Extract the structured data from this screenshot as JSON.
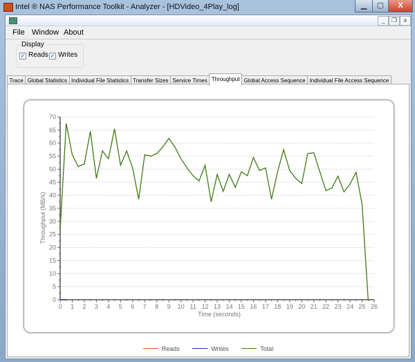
{
  "window": {
    "title": "Intel ® NAS Performance Toolkit - Analyzer - [HDVideo_4Play_log]",
    "min": "▁",
    "max": "▢",
    "close": "X"
  },
  "mdi": {
    "min": "_",
    "restore": "❐",
    "close": "x"
  },
  "menu": [
    "File",
    "Window",
    "About"
  ],
  "display": {
    "label": "Display",
    "reads": "Reads",
    "writes": "Writes",
    "reads_checked": true,
    "writes_checked": true,
    "check": "✓"
  },
  "tabs": [
    "Trace",
    "Global Statistics",
    "Individual File Statistics",
    "Transfer Sizes",
    "Service Times",
    "Throughput",
    "Global Access Sequence",
    "Individual File Access Sequence"
  ],
  "active_tab": "Throughput",
  "chart_data": {
    "type": "line",
    "title": "",
    "xlabel": "Time (seconds)",
    "ylabel": "Throughput (MB/s)",
    "xlim": [
      0,
      26
    ],
    "ylim": [
      0,
      70
    ],
    "xticks": [
      0,
      1,
      2,
      3,
      4,
      5,
      6,
      7,
      8,
      9,
      10,
      11,
      12,
      13,
      14,
      15,
      16,
      17,
      18,
      19,
      20,
      21,
      22,
      23,
      24,
      25,
      26
    ],
    "yticks": [
      0,
      5,
      10,
      15,
      20,
      25,
      30,
      35,
      40,
      45,
      50,
      55,
      60,
      65,
      70
    ],
    "grid": "horizontal",
    "legend_position": "bottom",
    "series": [
      {
        "name": "Reads",
        "color": "#d9532c",
        "x": [
          0,
          0.5
        ],
        "values": [
          0,
          0
        ]
      },
      {
        "name": "Writes",
        "color": "#2a2ab0",
        "x": [
          0,
          0.5
        ],
        "values": [
          0,
          0
        ]
      },
      {
        "name": "Total",
        "color": "#3f7a12",
        "x": [
          0,
          0.5,
          1,
          1.5,
          2,
          2.5,
          3,
          3.5,
          4,
          4.5,
          5,
          5.5,
          6,
          6.5,
          7,
          7.5,
          8,
          8.5,
          9,
          9.5,
          10,
          10.5,
          11,
          11.5,
          12,
          12.5,
          13,
          13.5,
          14,
          14.5,
          15,
          15.5,
          16,
          16.5,
          17,
          17.5,
          18,
          18.5,
          19,
          19.5,
          20,
          20.5,
          21,
          21.5,
          22,
          22.5,
          23,
          23.5,
          24,
          24.5,
          25,
          25.5
        ],
        "values": [
          27,
          67.5,
          55.5,
          51,
          52,
          64.5,
          46.5,
          57,
          54,
          65.5,
          51.5,
          57,
          50.5,
          38.5,
          55.5,
          55,
          56,
          58.5,
          61.8,
          58.5,
          54,
          50.5,
          47.5,
          45.5,
          51.5,
          37.5,
          48,
          41.5,
          48,
          43,
          49,
          47.5,
          54.5,
          49.5,
          50.5,
          38.5,
          49,
          57.5,
          49.5,
          46.5,
          44.5,
          56,
          56.3,
          49,
          41.8,
          42.8,
          47.3,
          41.3,
          44.3,
          48.8,
          36.5,
          0
        ]
      }
    ]
  }
}
